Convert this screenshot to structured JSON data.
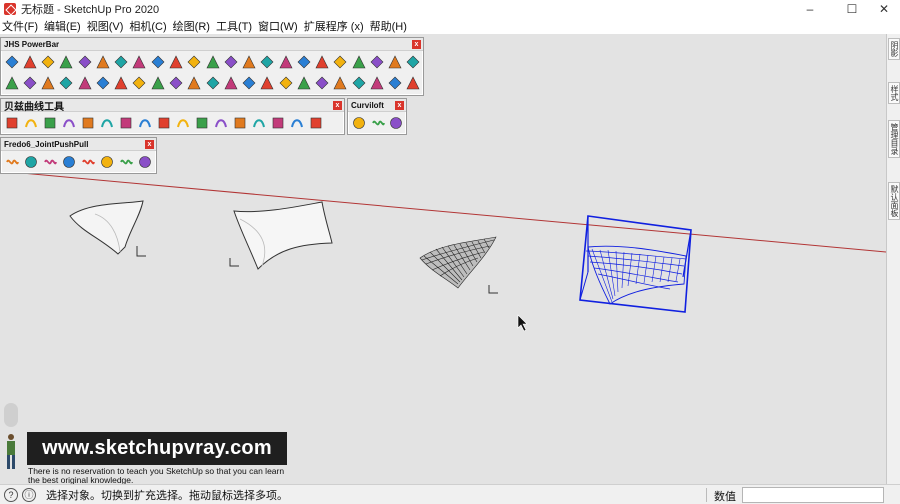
{
  "window": {
    "title": "无标题 - SketchUp Pro 2020",
    "minimize": "–",
    "maximize": "☐",
    "close": "✕"
  },
  "menu": [
    "文件(F)",
    "编辑(E)",
    "视图(V)",
    "相机(C)",
    "绘图(R)",
    "工具(T)",
    "窗口(W)",
    "扩展程序 (x)",
    "帮助(H)"
  ],
  "toolbars": {
    "jhs": {
      "title": "JHS PowerBar",
      "close": "x",
      "row1": [
        "push-pull-icon",
        "flip-icon",
        "select-face-icon",
        "green-face-icon",
        "erase-face-icon",
        "cube-outline-icon",
        "swirl-icon",
        "weld-icon",
        "twist-icon",
        "red-box-icon",
        "bed-icon",
        "flag-icon",
        "dumbbell-icon",
        "pipe-icon",
        "vine-icon",
        "lasso-icon",
        "curve-dots-icon",
        "cross-arrows-icon",
        "component-icon",
        "grid-select-icon",
        "cross-icon",
        "tower-icon",
        "shape-icon"
      ],
      "row2": [
        "triangle-icon",
        "loop-icon",
        "rotate-icon",
        "reload-icon",
        "move-icon",
        "chain-icon",
        "undo-red-icon",
        "bucket-icon",
        "rocking-chair-icon",
        "shield-face-icon",
        "stack-icon",
        "tree-icon",
        "rings-icon",
        "zoom-circle-icon",
        "ladder-icon",
        "bench-icon",
        "table-icon",
        "panel-icon",
        "grid-orange-icon",
        "grid-yellow-icon",
        "scatter-icon",
        "dots-curve-icon",
        "printer-icon"
      ]
    },
    "bezier": {
      "title": "贝兹曲线工具",
      "close": "x",
      "icons": [
        "arc-points-icon",
        "wave-icon",
        "brush-curve-icon",
        "bezier-n-icon",
        "spline-i-icon",
        "curve-c-icon",
        "square-outline-icon",
        "spiral-icon",
        "s-curve-icon",
        "n-curve-icon",
        "hook-icon",
        "arc-red-icon",
        "wave-blue-icon",
        "gear-outline-icon",
        "wrench-icon",
        "circle-outline-icon",
        "triangle-outline-icon"
      ]
    },
    "curviloft": {
      "title": "Curviloft",
      "close": "x",
      "icons": [
        "loft-shield-icon",
        "skin-icon",
        "sphere-icon"
      ]
    },
    "fredo": {
      "title": "Fredo6_JointPushPull",
      "close": "x",
      "icons": [
        "joint-pushpull-icon",
        "vector-pushpull-icon",
        "normal-pushpull-icon",
        "extrude-icon",
        "thicken-icon",
        "offset-icon",
        "round-pushpull-icon",
        "finish-icon"
      ]
    }
  },
  "tray_tabs": [
    "阴影",
    "样式",
    "管理目录",
    "默认面板"
  ],
  "watermark": {
    "url": "www.sketchupvray.com",
    "line1": "There is no reservation to teach you SketchUp so that you can learn",
    "line2": "the best original knowledge."
  },
  "status": {
    "message": "选择对象。切换到扩充选择。拖动鼠标选择多项。",
    "measure_label": "数值",
    "measure_value": ""
  },
  "colors": {
    "accent_red": "#d9342b",
    "selection_blue": "#1020e0",
    "axis_red": "#b23535"
  }
}
